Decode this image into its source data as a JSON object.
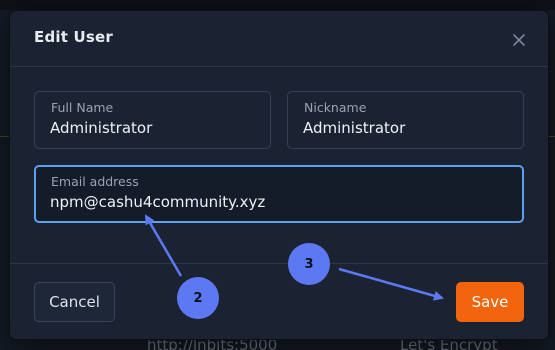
{
  "background": {
    "left_text": "http://lnbits:5000",
    "right_text": "Let's Encrypt"
  },
  "modal": {
    "title": "Edit User",
    "close_icon": "close-icon",
    "fields": {
      "full_name": {
        "label": "Full Name",
        "value": "Administrator"
      },
      "nickname": {
        "label": "Nickname",
        "value": "Administrator"
      },
      "email": {
        "label": "Email address",
        "value": "npm@cashu4community.xyz"
      }
    },
    "buttons": {
      "cancel": "Cancel",
      "save": "Save"
    }
  },
  "annotations": {
    "badge_2": "2",
    "badge_3": "3",
    "color": "#5c79f3"
  },
  "colors": {
    "save_button": "#f2650c",
    "focus_border": "#5ea0f0",
    "modal_bg": "#1b2333"
  }
}
